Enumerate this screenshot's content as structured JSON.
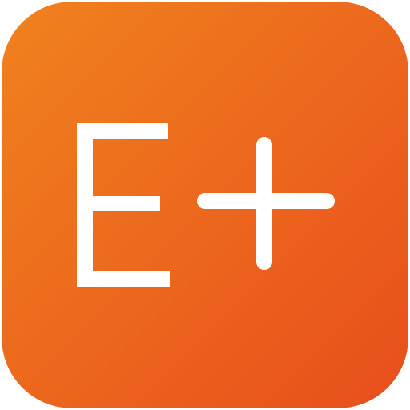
{
  "icon": {
    "letter": "E",
    "symbol": "plus-icon",
    "colors": {
      "gradient_start": "#F0821E",
      "gradient_end": "#E84E1C",
      "glyph": "#FFFFFF"
    }
  }
}
